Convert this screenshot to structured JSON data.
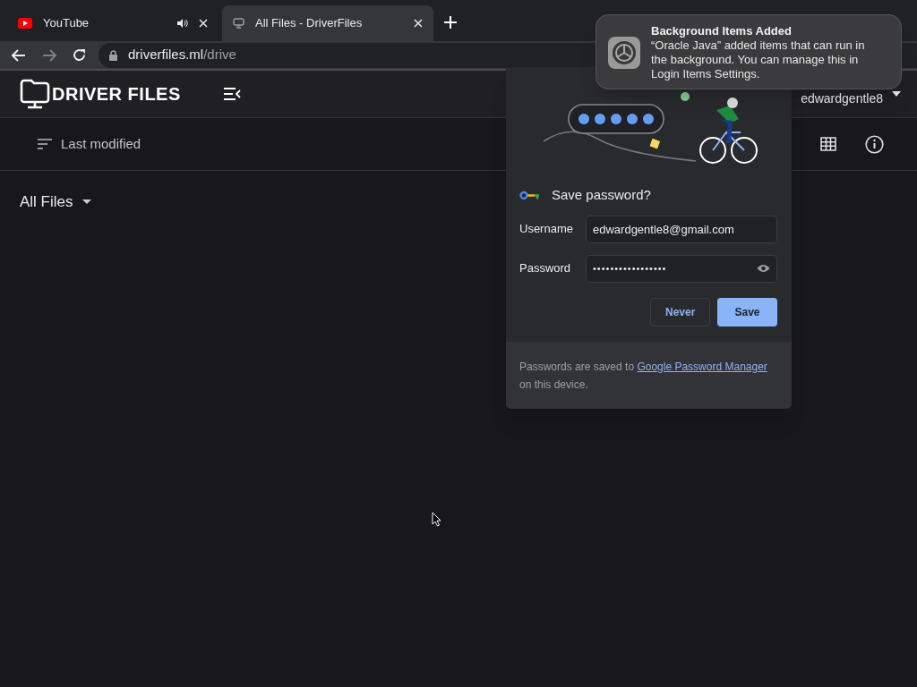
{
  "browser": {
    "tabs": [
      {
        "title": "YouTube",
        "kind": "video",
        "audio": true,
        "selected": false
      },
      {
        "title": "All Files - DriverFiles",
        "kind": "page",
        "audio": false,
        "selected": true
      }
    ],
    "url_host": "driverfiles.ml",
    "url_path": "/drive"
  },
  "app": {
    "logo": "DRIVER FILES",
    "user": "edwardgentle8",
    "sort": "Last modified",
    "breadcrumb": "All Files"
  },
  "password_popup": {
    "title": "Save password?",
    "username_label": "Username",
    "username": "edwardgentle8@gmail.com",
    "password_label": "Password",
    "password": "•••••••••••••••••",
    "buttons": [
      {
        "label": "Never",
        "primary": false
      },
      {
        "label": "Save",
        "primary": true
      }
    ],
    "footer_before": "Passwords are saved to",
    "footer_link": "Google Password Manager",
    "footer_after": "on this device."
  },
  "notification": {
    "title": "Background Items Added",
    "body": "“Oracle Java” added items that can run in the background. You can manage this in Login Items Settings."
  }
}
